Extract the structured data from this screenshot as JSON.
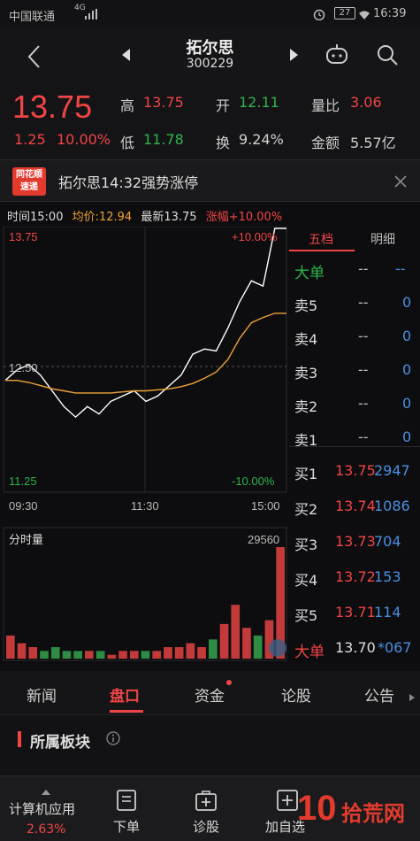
{
  "status": {
    "carrier": "中国联通",
    "net": "4G",
    "battery": "27",
    "time": "16:39"
  },
  "nav": {
    "title": "拓尔思",
    "code": "300229"
  },
  "quote": {
    "price": "13.75",
    "change": "1.25",
    "change_pct": "10.00%",
    "high_label": "高",
    "high": "13.75",
    "open_label": "开",
    "open": "12.11",
    "vol_ratio_label": "量比",
    "vol_ratio": "3.06",
    "low_label": "低",
    "low": "11.78",
    "turnover_label": "换",
    "turnover": "9.24%",
    "amount_label": "金额",
    "amount": "5.57亿"
  },
  "banner": {
    "badge_line1": "同花顺",
    "badge_line2": "速递",
    "text": "拓尔思14:32强势涨停"
  },
  "chart_info": {
    "time": "时间15:00",
    "avg": "均价:12.94",
    "latest": "最新13.75",
    "pct": "涨幅+10.00%"
  },
  "chart_labels": {
    "top_price": "13.75",
    "top_pct": "+10.00%",
    "mid_price": "12.50",
    "bottom_price": "11.25",
    "bottom_pct": "-10.00%",
    "t_start": "09:30",
    "t_mid": "11:30",
    "t_end": "15:00",
    "vol_title": "分时量",
    "vol_max": "29560"
  },
  "chart_data": {
    "type": "line",
    "ylim": [
      11.25,
      13.75
    ],
    "series": [
      {
        "name": "",
        "values": [
          12.3,
          12.4,
          12.45,
          12.35,
          12.2,
          12.05,
          11.95,
          12.05,
          11.98,
          12.1,
          12.15,
          12.2,
          12.1,
          12.15,
          12.25,
          12.35,
          12.55,
          12.6,
          12.58,
          12.8,
          13.05,
          13.25,
          13.2,
          13.75,
          13.75
        ]
      },
      {
        "name": "",
        "values": [
          12.3,
          12.3,
          12.28,
          12.25,
          12.22,
          12.2,
          12.18,
          12.18,
          12.18,
          12.18,
          12.19,
          12.2,
          12.2,
          12.21,
          12.22,
          12.24,
          12.27,
          12.32,
          12.38,
          12.5,
          12.7,
          12.85,
          12.9,
          12.94,
          12.94
        ]
      }
    ],
    "volume": [
      6,
      4,
      3,
      2,
      3,
      2,
      2,
      2,
      2,
      1,
      2,
      2,
      2,
      2,
      3,
      3,
      4,
      3,
      5,
      9,
      14,
      8,
      6,
      10,
      29
    ]
  },
  "order_book": {
    "tab_active": "五档",
    "tab_other": "明细",
    "big_sell_label": "大单",
    "big_sell_a": "--",
    "big_sell_b": "--",
    "sells": [
      {
        "label": "卖5",
        "price": "--",
        "vol": "0"
      },
      {
        "label": "卖4",
        "price": "--",
        "vol": "0"
      },
      {
        "label": "卖3",
        "price": "--",
        "vol": "0"
      },
      {
        "label": "卖2",
        "price": "--",
        "vol": "0"
      },
      {
        "label": "卖1",
        "price": "--",
        "vol": "0"
      }
    ],
    "buys": [
      {
        "label": "买1",
        "price": "13.75",
        "vol": "2947"
      },
      {
        "label": "买2",
        "price": "13.74",
        "vol": "1086"
      },
      {
        "label": "买3",
        "price": "13.73",
        "vol": "704"
      },
      {
        "label": "买4",
        "price": "13.72",
        "vol": "153"
      },
      {
        "label": "买5",
        "price": "13.71",
        "vol": "114"
      }
    ],
    "big_buy_label": "大单",
    "big_buy_price": "13.70",
    "big_buy_vol": "*067"
  },
  "tabs": [
    "新闻",
    "盘口",
    "资金",
    "论股",
    "公告"
  ],
  "section_title": "所属板块",
  "bottom_nav": {
    "sector": "计算机应用",
    "sector_pct": "2.63%",
    "order": "下单",
    "diagnose": "诊股",
    "add": "加自选"
  },
  "watermark": "拾荒网"
}
